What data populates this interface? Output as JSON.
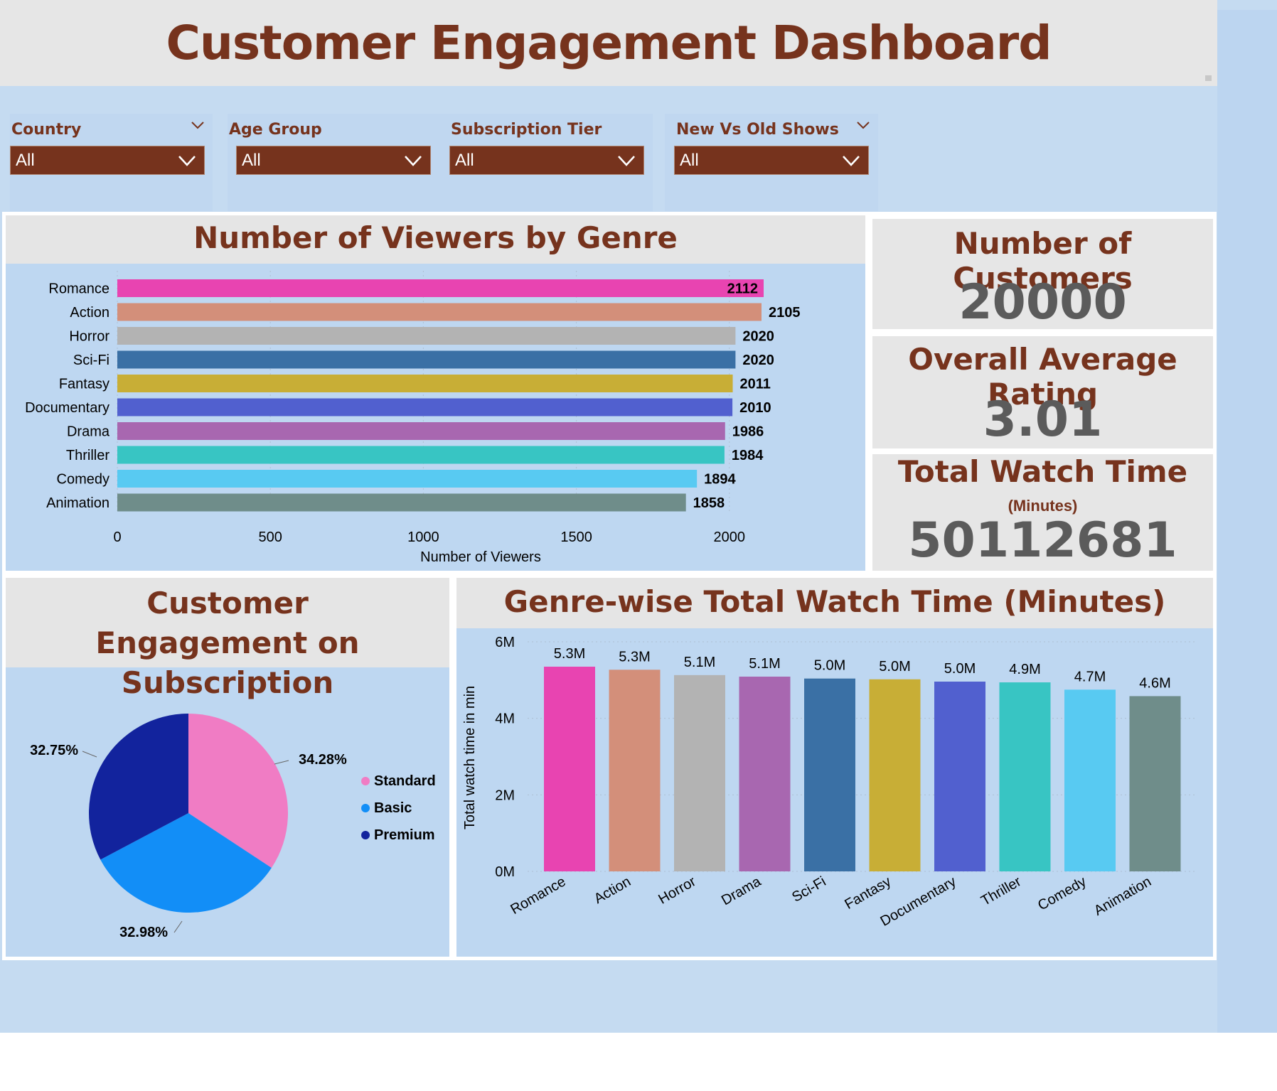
{
  "header": {
    "title": "Customer Engagement Dashboard"
  },
  "filters": [
    {
      "label": "Country",
      "value": "All"
    },
    {
      "label": "Age Group",
      "value": "All"
    },
    {
      "label": "Subscription Tier",
      "value": "All"
    },
    {
      "label": "New Vs Old Shows",
      "value": "All"
    }
  ],
  "kpis": {
    "customers": {
      "title": "Number of Customers",
      "value": "20000"
    },
    "rating": {
      "title": "Overall Average Rating",
      "value": "3.01"
    },
    "watch_time": {
      "title": "Total Watch Time",
      "subtitle": "(Minutes)",
      "value": "50112681"
    }
  },
  "colors": {
    "accent": "#76331d",
    "panel_bg": "#bed7f1",
    "header_bg": "#e6e6e6"
  },
  "chart_data": [
    {
      "type": "bar",
      "orientation": "horizontal",
      "title": "Number of Viewers by Genre",
      "xlabel": "Number of Viewers",
      "ylabel": "",
      "xlim": [
        0,
        2112
      ],
      "xticks": [
        0,
        500,
        1000,
        1500,
        2000
      ],
      "categories": [
        "Romance",
        "Action",
        "Horror",
        "Sci-Fi",
        "Fantasy",
        "Documentary",
        "Drama",
        "Thriller",
        "Comedy",
        "Animation"
      ],
      "values": [
        2112,
        2105,
        2020,
        2020,
        2011,
        2010,
        1986,
        1984,
        1894,
        1858
      ],
      "colors": [
        "#e844b1",
        "#d38f7a",
        "#b3b3b3",
        "#3a70a5",
        "#c8ae36",
        "#5160cf",
        "#a867b0",
        "#38c5c3",
        "#58caf2",
        "#6f8d8a"
      ],
      "data_labels": [
        "2112",
        "2105",
        "2020",
        "2020",
        "2011",
        "2010",
        "1986",
        "1984",
        "1894",
        "1858"
      ]
    },
    {
      "type": "pie",
      "title": "Customer Engagement on Subscription",
      "categories": [
        "Standard",
        "Basic",
        "Premium"
      ],
      "values": [
        34.28,
        32.98,
        32.75
      ],
      "data_labels": [
        "34.28%",
        "32.98%",
        "32.75%"
      ],
      "colors": [
        "#f07cc4",
        "#128ef7",
        "#12239d"
      ],
      "legend": "right"
    },
    {
      "type": "bar",
      "title": "Genre-wise Total Watch Time (Minutes)",
      "xlabel": "",
      "ylabel": "Total watch time in min",
      "ylim": [
        0,
        6000000
      ],
      "yticks": [
        0,
        2000000,
        4000000,
        6000000
      ],
      "ytick_labels": [
        "0M",
        "2M",
        "4M",
        "6M"
      ],
      "categories": [
        "Romance",
        "Action",
        "Horror",
        "Drama",
        "Sci-Fi",
        "Fantasy",
        "Documentary",
        "Thriller",
        "Comedy",
        "Animation"
      ],
      "values": [
        5350000,
        5270000,
        5130000,
        5090000,
        5040000,
        5020000,
        4960000,
        4940000,
        4750000,
        4580000
      ],
      "data_labels": [
        "5.3M",
        "5.3M",
        "5.1M",
        "5.1M",
        "5.0M",
        "5.0M",
        "5.0M",
        "4.9M",
        "4.7M",
        "4.6M"
      ],
      "colors": [
        "#e844b1",
        "#d38f7a",
        "#b3b3b3",
        "#a867b0",
        "#3a70a5",
        "#c8ae36",
        "#5160cf",
        "#38c5c3",
        "#58caf2",
        "#6f8d8a"
      ],
      "grid": true
    }
  ]
}
